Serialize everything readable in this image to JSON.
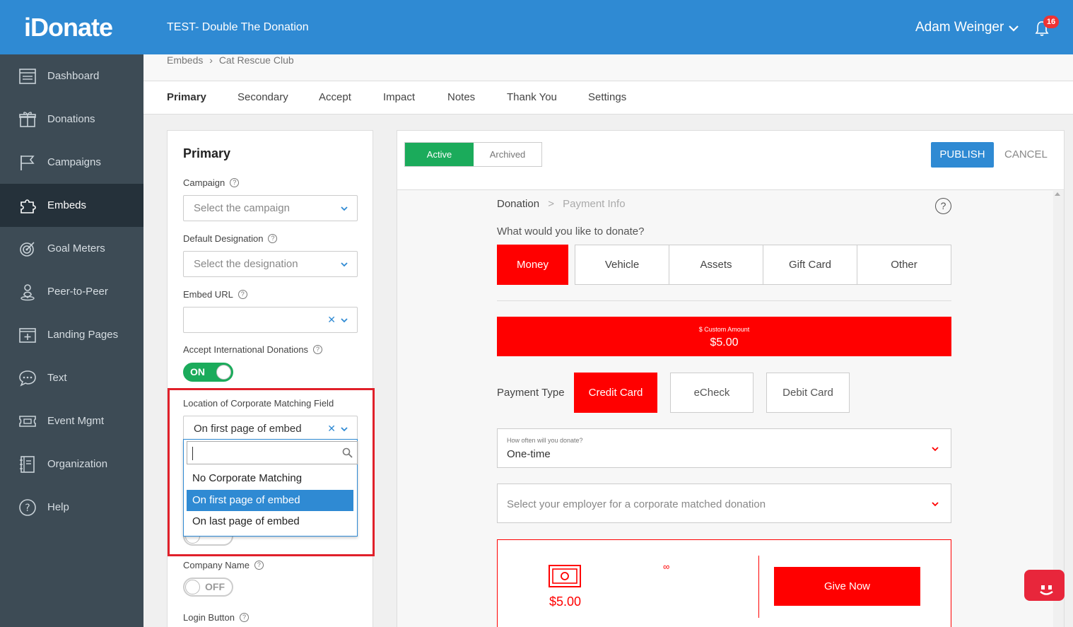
{
  "app": {
    "logo": "iDonate",
    "org_title": "TEST- Double The Donation"
  },
  "user": {
    "name": "Adam Weinger",
    "notifications": "16"
  },
  "sidebar": {
    "items": [
      {
        "label": "Dashboard",
        "icon": "dashboard-icon"
      },
      {
        "label": "Donations",
        "icon": "gift-icon"
      },
      {
        "label": "Campaigns",
        "icon": "flag-icon"
      },
      {
        "label": "Embeds",
        "icon": "puzzle-icon",
        "active": true
      },
      {
        "label": "Goal Meters",
        "icon": "target-icon"
      },
      {
        "label": "Peer-to-Peer",
        "icon": "person-pin-icon"
      },
      {
        "label": "Landing Pages",
        "icon": "landing-page-icon"
      },
      {
        "label": "Text",
        "icon": "chat-bubble-icon"
      },
      {
        "label": "Event Mgmt",
        "icon": "ticket-icon"
      },
      {
        "label": "Organization",
        "icon": "organization-icon"
      },
      {
        "label": "Help",
        "icon": "help-icon"
      }
    ]
  },
  "breadcrumb": {
    "parent": "Embeds",
    "separator": "›",
    "current": "Cat Rescue Club"
  },
  "tabs": [
    "Primary",
    "Secondary",
    "Accept",
    "Impact",
    "Notes",
    "Thank You",
    "Settings"
  ],
  "panel": {
    "title": "Primary",
    "campaign": {
      "label": "Campaign",
      "placeholder": "Select the campaign"
    },
    "designation": {
      "label": "Default Designation",
      "placeholder": "Select the designation"
    },
    "embed_url": {
      "label": "Embed URL",
      "value": ""
    },
    "international": {
      "label": "Accept International Donations",
      "state": "ON"
    },
    "corporate": {
      "label": "Location of Corporate Matching Field",
      "value": "On first page of embed",
      "search_value": "",
      "options": [
        "No Corporate Matching",
        "On first page of embed",
        "On last page of embed"
      ],
      "selected_index": 1
    },
    "company_name": {
      "label": "Company Name",
      "state": "OFF"
    },
    "login_button": {
      "label": "Login Button"
    }
  },
  "actions": {
    "active": "Active",
    "archived": "Archived",
    "publish": "PUBLISH",
    "cancel": "CANCEL"
  },
  "preview": {
    "crumb_step1": "Donation",
    "crumb_sep": ">",
    "crumb_step2": "Payment Info",
    "help": "?",
    "question": "What would you like to donate?",
    "donation_types": [
      "Money",
      "Vehicle",
      "Assets",
      "Gift Card",
      "Other"
    ],
    "custom_amount_label": "$ Custom Amount",
    "custom_amount_value": "$5.00",
    "payment_type_label": "Payment Type",
    "payment_types": [
      "Credit Card",
      "eCheck",
      "Debit Card"
    ],
    "frequency_label": "How often will you donate?",
    "frequency_value": "One-time",
    "employer_placeholder": "Select your employer for a corporate matched donation",
    "summary_amount": "$5.00",
    "summary_infinity": "∞",
    "give_now": "Give Now"
  },
  "colors": {
    "brand_blue": "#2f8ad3",
    "sidebar": "#3d4b55",
    "green": "#1bab5b",
    "red": "#ff0000",
    "highlight": "#e0202a"
  }
}
